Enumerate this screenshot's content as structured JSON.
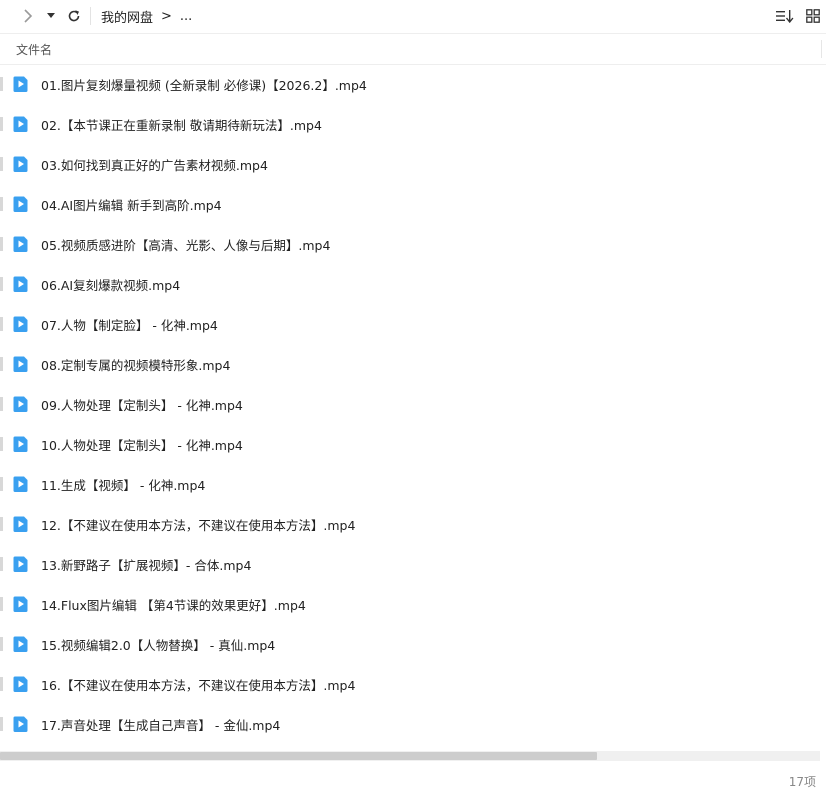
{
  "toolbar": {
    "breadcrumb": [
      "我的网盘",
      ">",
      "..."
    ]
  },
  "table": {
    "header_name": "文件名"
  },
  "files": [
    "01.图片复刻爆量视频 (全新录制 必修课)【2026.2】.mp4",
    "02.【本节课正在重新录制 敬请期待新玩法】.mp4",
    "03.如何找到真正好的广告素材视频.mp4",
    "04.AI图片编辑 新手到高阶.mp4",
    "05.视频质感进阶【高清、光影、人像与后期】.mp4",
    "06.AI复刻爆款视频.mp4",
    "07.人物【制定脸】 - 化神.mp4",
    "08.定制专属的视频模特形象.mp4",
    "09.人物处理【定制头】 - 化神.mp4",
    "10.人物处理【定制头】 - 化神.mp4",
    "11.生成【视频】 - 化神.mp4",
    "12.【不建议在使用本方法，不建议在使用本方法】.mp4",
    "13.新野路子【扩展视频】- 合体.mp4",
    "14.Flux图片编辑 【第4节课的效果更好】.mp4",
    "15.视频编辑2.0【人物替换】 - 真仙.mp4",
    "16.【不建议在使用本方法，不建议在使用本方法】.mp4",
    "17.声音处理【生成自己声音】 - 金仙.mp4"
  ],
  "status": {
    "count": "17项"
  },
  "colors": {
    "icon_blue": "#3aa0f0",
    "text": "#222222"
  },
  "icons": {
    "forward": "chevron-right-icon",
    "dropdown": "caret-down-icon",
    "refresh": "refresh-icon",
    "sort": "sort-icon",
    "grid": "grid-view-icon",
    "file": "video-file-icon"
  }
}
